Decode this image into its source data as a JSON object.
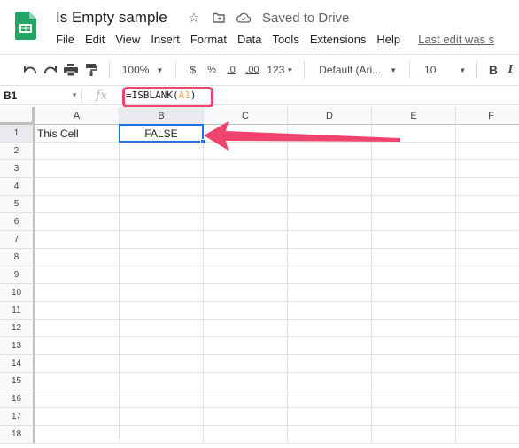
{
  "app": {
    "title": "Is Empty sample",
    "saved_status": "Saved to Drive",
    "icons": {
      "star": "star-icon",
      "move": "move-to-folder-icon",
      "cloud": "cloud-saved-icon"
    }
  },
  "menu": {
    "items": [
      "File",
      "Edit",
      "View",
      "Insert",
      "Format",
      "Data",
      "Tools",
      "Extensions",
      "Help"
    ],
    "last_edit": "Last edit was s"
  },
  "toolbar": {
    "zoom": "100%",
    "currency": "$",
    "percent": "%",
    "decrease_decimal": ".0",
    "increase_decimal": ".00",
    "number_format": "123",
    "font": "Default (Ari...",
    "font_size": "10",
    "bold": "B",
    "italic": "I"
  },
  "formula_bar": {
    "name_box": "B1",
    "fx": "fx",
    "formula_prefix": "=ISBLANK(",
    "formula_ref": "A1",
    "formula_suffix": ")"
  },
  "grid": {
    "columns": [
      "A",
      "B",
      "C",
      "D",
      "E",
      "F"
    ],
    "rows": [
      "1",
      "2",
      "3",
      "4",
      "5",
      "6",
      "7",
      "8",
      "9",
      "10",
      "11",
      "12",
      "13",
      "14",
      "15",
      "16",
      "17",
      "18"
    ],
    "cells": {
      "A1": "This Cell",
      "B1": "FALSE"
    },
    "selected_cell": "B1"
  },
  "annotation": {
    "highlight_color": "#f0446e",
    "selection_color": "#1a73e8"
  }
}
